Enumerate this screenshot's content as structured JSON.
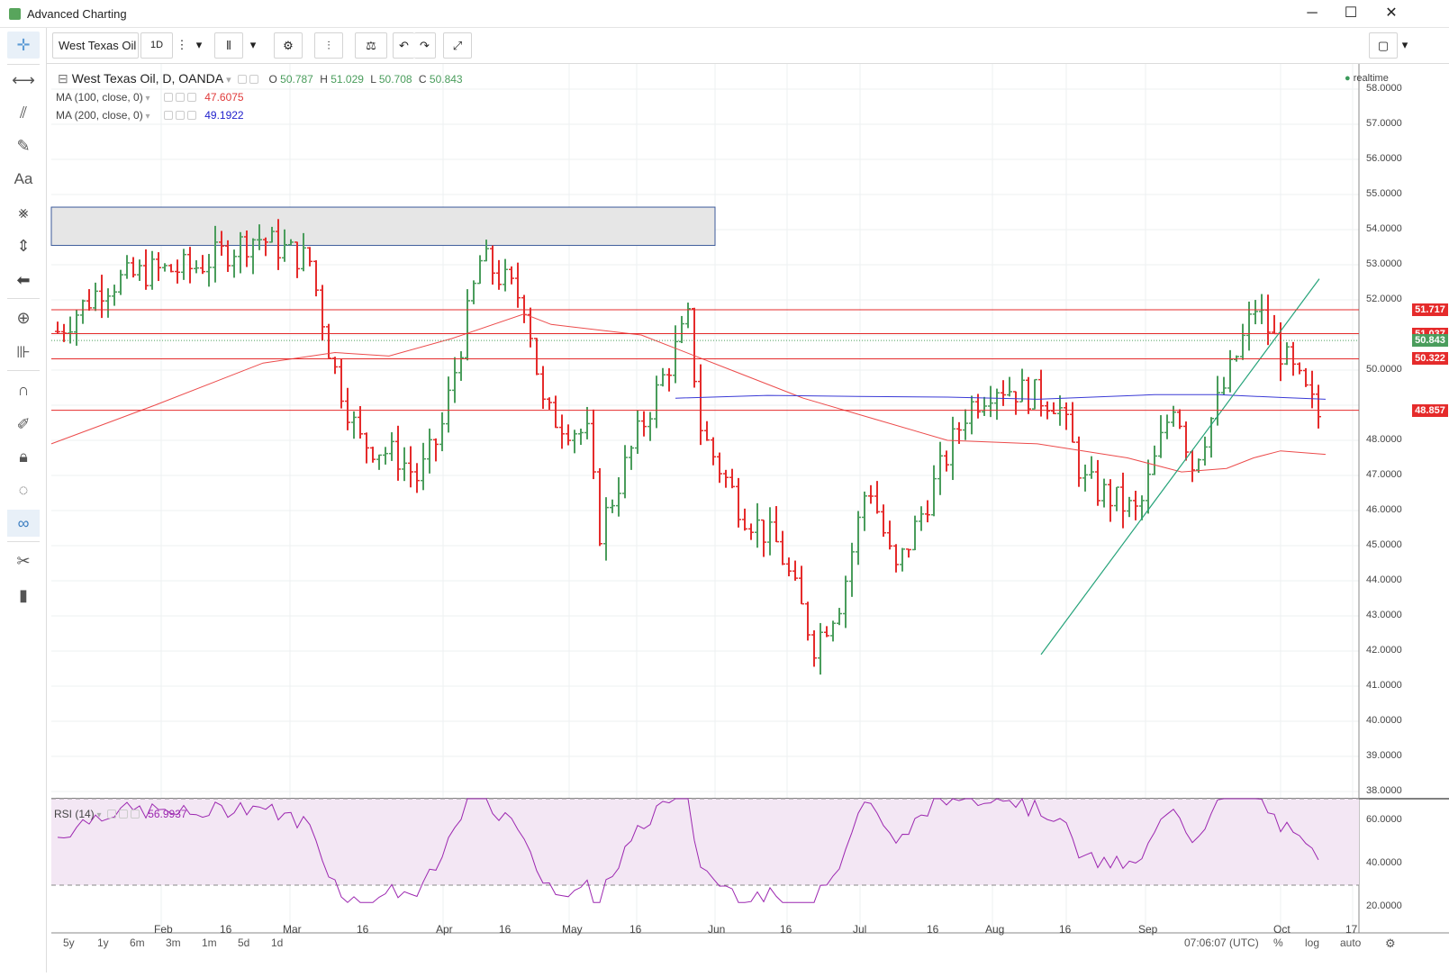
{
  "window": {
    "title": "Advanced Charting",
    "minimize": "─",
    "maximize": "☐",
    "close": "✕"
  },
  "toolbar": {
    "symbol": "West Texas Oil",
    "interval": "1D",
    "more": "⋮",
    "dropdown": "▾"
  },
  "legend": {
    "title": "West Texas Oil, D, OANDA",
    "ohlc": {
      "o_label": "O",
      "o": "50.787",
      "h_label": "H",
      "h": "51.029",
      "l_label": "L",
      "l": "50.708",
      "c_label": "C",
      "c": "50.843"
    },
    "ma100": {
      "label": "MA (100, close, 0)",
      "value": "47.6075",
      "color": "#e03a3a"
    },
    "ma200": {
      "label": "MA (200, close, 0)",
      "value": "49.1922",
      "color": "#2222cc"
    },
    "realtime": "realtime",
    "rsi": {
      "label": "RSI (14)",
      "value": "56.9937",
      "color": "#9c27b0"
    }
  },
  "price_axis": [
    "58.0000",
    "57.0000",
    "56.0000",
    "55.0000",
    "54.0000",
    "53.0000",
    "52.0000",
    "50.0000",
    "48.0000",
    "47.0000",
    "46.0000",
    "45.0000",
    "44.0000",
    "43.0000",
    "42.0000",
    "41.0000",
    "40.0000",
    "39.0000",
    "38.0000"
  ],
  "rsi_axis": [
    "60.0000",
    "40.0000",
    "20.0000"
  ],
  "price_labels": [
    {
      "text": "51.717",
      "value": 51.717,
      "color": "#e52b2b"
    },
    {
      "text": "51.037",
      "value": 51.037,
      "color": "#e52b2b"
    },
    {
      "text": "50.843",
      "value": 50.843,
      "color": "#4a9d5c"
    },
    {
      "text": "50.322",
      "value": 50.322,
      "color": "#e52b2b"
    },
    {
      "text": "48.857",
      "value": 48.857,
      "color": "#e52b2b"
    }
  ],
  "time_axis": [
    "Feb",
    "16",
    "Mar",
    "16",
    "Apr",
    "16",
    "May",
    "16",
    "Jun",
    "16",
    "Jul",
    "16",
    "Aug",
    "16",
    "Sep",
    "Oct",
    "17"
  ],
  "bottom": {
    "ranges": [
      "5y",
      "1y",
      "6m",
      "3m",
      "1m",
      "5d",
      "1d"
    ],
    "time": "07:06:07 (UTC)",
    "percent": "%",
    "log": "log",
    "auto": "auto"
  },
  "colors": {
    "up": "#4a9d5c",
    "down": "#e52b2b",
    "rsi": "#9c27b0",
    "trend": "#26a37a"
  }
}
